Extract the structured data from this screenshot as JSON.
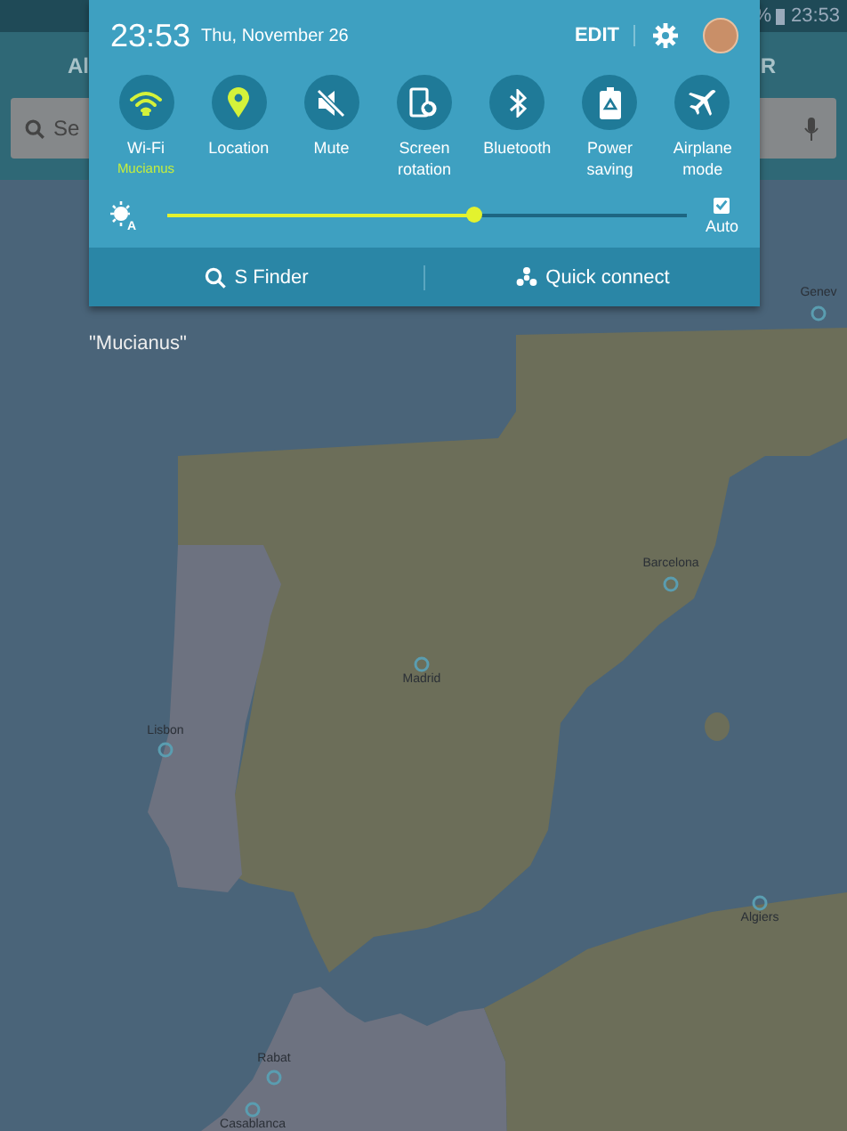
{
  "status_bar": {
    "battery": "%",
    "time": "23:53"
  },
  "background_app": {
    "tabs": [
      {
        "label": "Al"
      },
      {
        "label": "R"
      }
    ],
    "search": {
      "placeholder": "Se"
    }
  },
  "map": {
    "network_label": "\"Mucianus\"",
    "cities": [
      {
        "name": "Genev"
      },
      {
        "name": "Barcelona"
      },
      {
        "name": "Madrid"
      },
      {
        "name": "Lisbon"
      },
      {
        "name": "Algiers"
      },
      {
        "name": "Rabat"
      },
      {
        "name": "Casablanca"
      }
    ]
  },
  "quick_panel": {
    "time": "23:53",
    "date": "Thu, November 26",
    "edit": "EDIT",
    "tiles": [
      {
        "kind": "wifi",
        "label": "Wi-Fi",
        "subtitle": "Mucianus",
        "on": true
      },
      {
        "kind": "location",
        "label": "Location",
        "on": true
      },
      {
        "kind": "mute",
        "label": "Mute",
        "on": false
      },
      {
        "kind": "rotation",
        "label": "Screen rotation",
        "on": false
      },
      {
        "kind": "bluetooth",
        "label": "Bluetooth",
        "on": false
      },
      {
        "kind": "power",
        "label": "Power saving",
        "on": false
      },
      {
        "kind": "airplane",
        "label": "Airplane mode",
        "on": false
      }
    ],
    "brightness": {
      "icon_text": "A",
      "level": 0.59,
      "auto_label": "Auto",
      "auto_checked": true
    },
    "actions": [
      {
        "kind": "search",
        "label": "S Finder"
      },
      {
        "kind": "connect",
        "label": "Quick connect"
      }
    ]
  }
}
